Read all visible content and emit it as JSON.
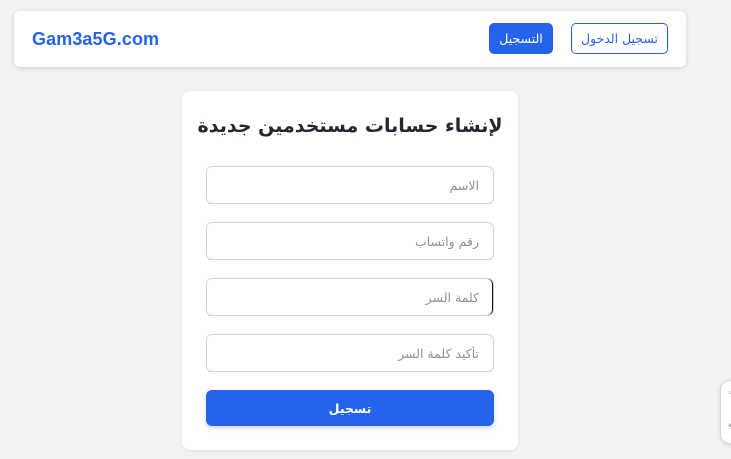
{
  "navbar": {
    "brand": "Gam3a5G.com",
    "register_label": "التسجيل",
    "login_label": "تسجيل الدخول"
  },
  "form": {
    "title": "لإنشاء حسابات مستخدمين جديدة",
    "fields": [
      {
        "name": "name",
        "placeholder": "الاسم",
        "value": ""
      },
      {
        "name": "whatsapp",
        "placeholder": "رقم واتساب",
        "value": ""
      },
      {
        "name": "password",
        "placeholder": "كلمة السر",
        "value": ""
      },
      {
        "name": "confirm_password",
        "placeholder": "تأكيد كلمة السر",
        "value": ""
      }
    ],
    "submit_label": "تسجيل"
  },
  "colors": {
    "accent": "#2563eb",
    "background": "#f1f2f4",
    "title_text": "#222831"
  }
}
